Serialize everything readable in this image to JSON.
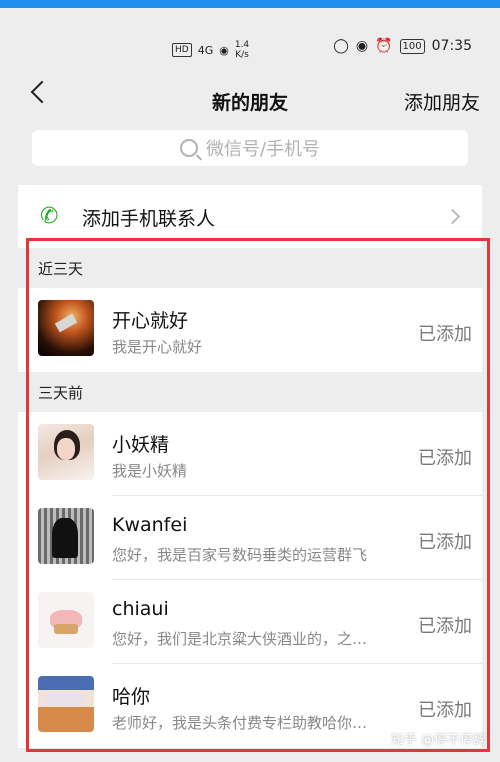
{
  "status_bar": {
    "hd": "HD",
    "signal": "4G",
    "speed_value": "1.4",
    "speed_unit": "K/s",
    "battery": "100",
    "time": "07:35"
  },
  "nav": {
    "back_icon": "chevron-left-icon",
    "title": "新的朋友",
    "action": "添加朋友"
  },
  "search": {
    "placeholder": "微信号/手机号"
  },
  "add_phone_contacts": {
    "label": "添加手机联系人"
  },
  "sections": [
    {
      "header": "近三天",
      "items": [
        {
          "name": "开心就好",
          "message": "我是开心就好",
          "status": "已添加"
        }
      ]
    },
    {
      "header": "三天前",
      "items": [
        {
          "name": "小妖精",
          "message": "我是小妖精",
          "status": "已添加"
        },
        {
          "name": "Kwanfei",
          "message": "您好，我是百家号数码垂类的运营群飞",
          "status": "已添加"
        },
        {
          "name": "chiaui",
          "message": "您好，我们是北京粱大侠酒业的，之…",
          "status": "已添加"
        },
        {
          "name": "哈你",
          "message": "老师好，我是头条付费专栏助教哈你…",
          "status": "已添加"
        }
      ]
    }
  ],
  "watermark": "知乎 @停不停辞",
  "colors": {
    "top_accent": "#1f8ff0",
    "highlight_border": "#e8333a",
    "phone_icon": "#1aad19"
  }
}
